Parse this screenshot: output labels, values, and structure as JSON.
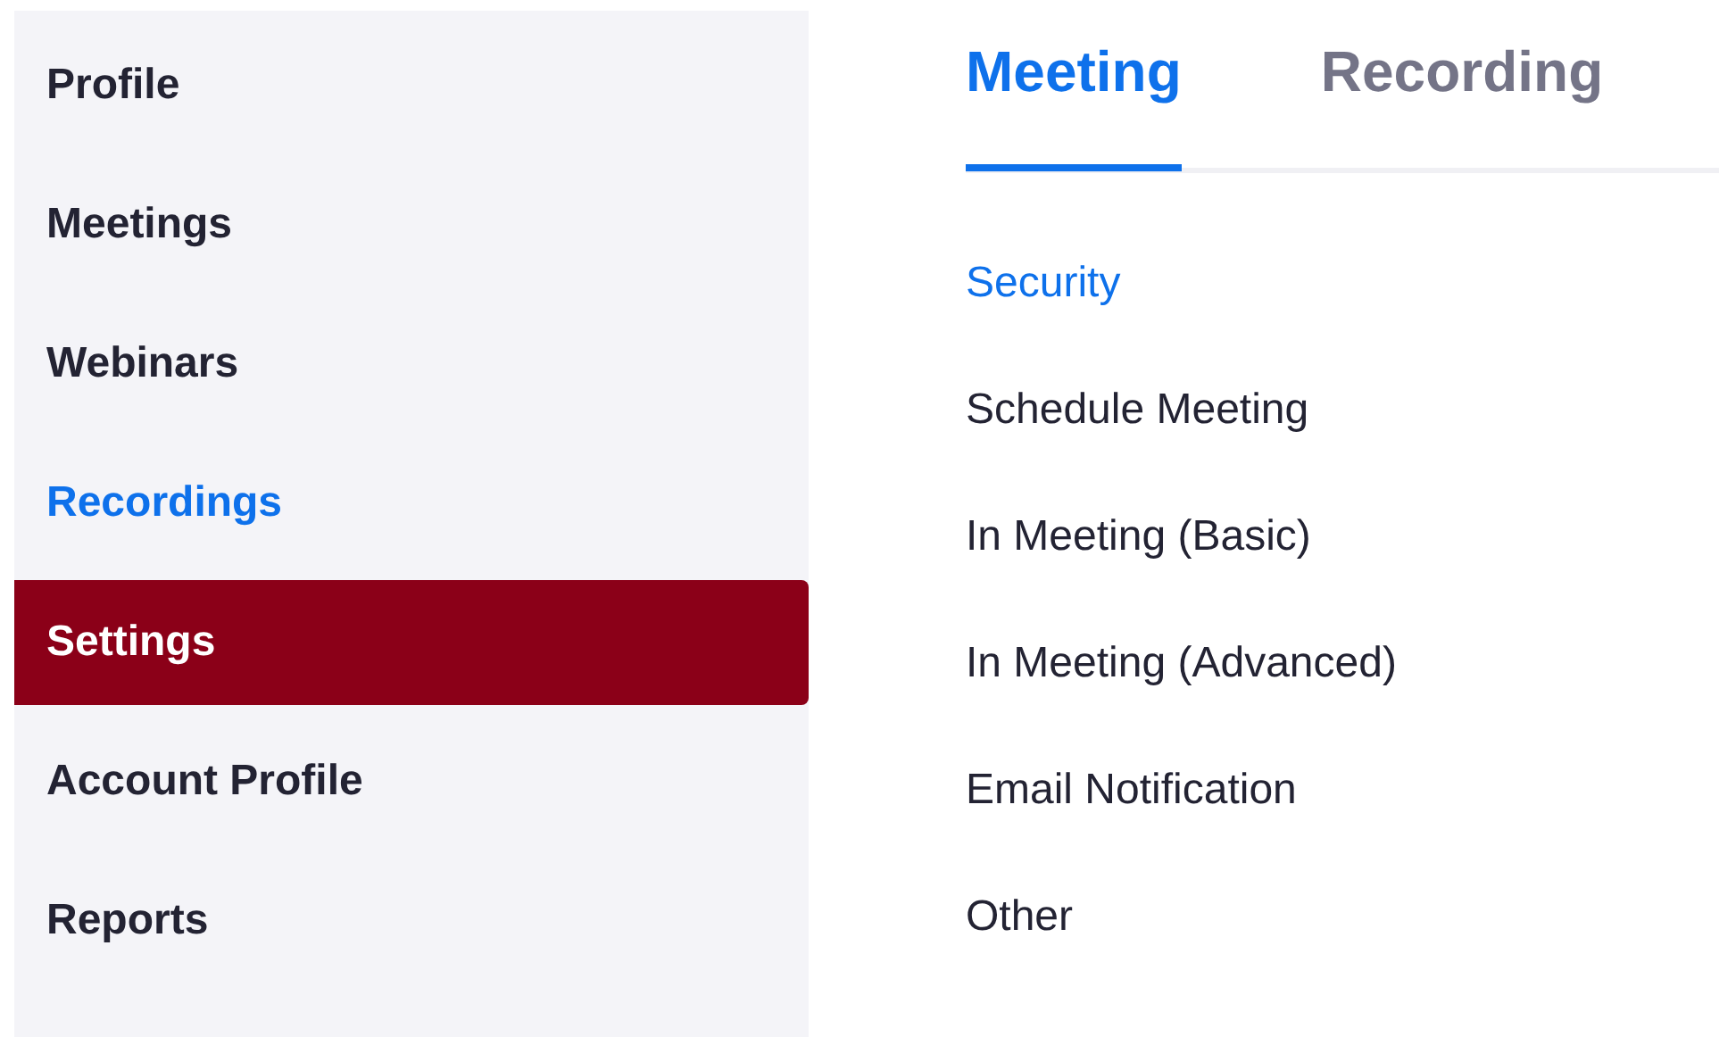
{
  "sidebar": {
    "items": [
      {
        "label": "Profile",
        "kind": "item",
        "selected": false
      },
      {
        "label": "Meetings",
        "kind": "item",
        "selected": false
      },
      {
        "label": "Webinars",
        "kind": "item",
        "selected": false
      },
      {
        "label": "Recordings",
        "kind": "link",
        "selected": false
      },
      {
        "label": "Settings",
        "kind": "item",
        "selected": true
      },
      {
        "label": "Account Profile",
        "kind": "item",
        "selected": false
      },
      {
        "label": "Reports",
        "kind": "item",
        "selected": false
      }
    ]
  },
  "tabs": [
    {
      "label": "Meeting",
      "selected": true
    },
    {
      "label": "Recording",
      "selected": false
    }
  ],
  "sections": [
    {
      "label": "Security",
      "selected": true
    },
    {
      "label": "Schedule Meeting",
      "selected": false
    },
    {
      "label": "In Meeting (Basic)",
      "selected": false
    },
    {
      "label": "In Meeting (Advanced)",
      "selected": false
    },
    {
      "label": "Email Notification",
      "selected": false
    },
    {
      "label": "Other",
      "selected": false
    }
  ]
}
